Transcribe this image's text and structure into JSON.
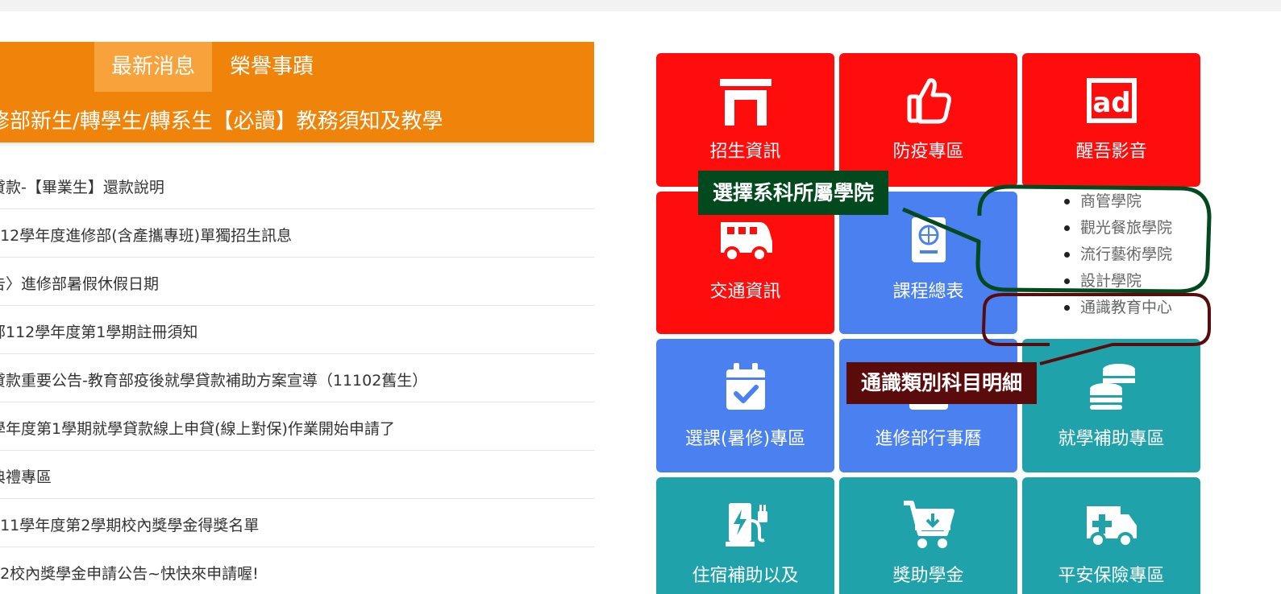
{
  "news": {
    "tabs": [
      "最新消息",
      "榮譽事蹟"
    ],
    "headline": "修部新生/轉學生/轉系生【必讀】教務須知及教學",
    "items": [
      "貸款-【畢業生】還款說明",
      "112學年度進修部(含產攜專班)單獨招生訊息",
      "告〉進修部暑假休假日期",
      "部112學年度第1學期註冊須知",
      "貸款重要公告-教育部疫後就學貸款補助方案宣導（11102舊生）",
      "學年度第1學期就學貸款線上申貸(線上對保)作業開始申請了",
      "典禮專區",
      "111學年度第2學期校內獎學金得獎名單",
      "02校內獎學金申請公告~快快來申請喔!"
    ]
  },
  "tiles": [
    {
      "label": "招生資訊",
      "icon": "gate-icon",
      "color": "#ff0c0c"
    },
    {
      "label": "防疫專區",
      "icon": "thumbs-up-icon",
      "color": "#ff0c0c"
    },
    {
      "label": "醒吾影音",
      "icon": "ad-icon",
      "color": "#ff0c0c"
    },
    {
      "label": "交通資訊",
      "icon": "van-icon",
      "color": "#ff0c0c"
    },
    {
      "label": "課程總表",
      "icon": "passport-icon",
      "color": "#4a80f0"
    },
    {
      "label": "選課(暑修)專區",
      "icon": "calendar-check-icon",
      "color": "#4a80f0"
    },
    {
      "label": "進修部行事曆",
      "icon": "calendar-icon",
      "color": "#4a80f0"
    },
    {
      "label": "就學補助專區",
      "icon": "coins-icon",
      "color": "#20a2aa"
    },
    {
      "label": "住宿補助以及",
      "icon": "charging-station-icon",
      "color": "#20a2aa"
    },
    {
      "label": "獎助學金",
      "icon": "cart-download-icon",
      "color": "#20a2aa"
    },
    {
      "label": "平安保險專區",
      "icon": "ambulance-icon",
      "color": "#20a2aa"
    }
  ],
  "colleges": [
    "商管學院",
    "觀光餐旅學院",
    "流行藝術學院",
    "設計學院",
    "通識教育中心"
  ],
  "annotations": {
    "green_label": "選擇系科所屬學院",
    "maroon_label": "通識類別科目明細"
  },
  "colors": {
    "news_header": "#f0840a",
    "active_tab": "#f7a23a",
    "tile_red": "#ff0c0c",
    "tile_blue": "#4a80f0",
    "tile_teal": "#20a2aa",
    "annotation_green": "#02491e",
    "annotation_maroon": "#5a0c0c"
  }
}
